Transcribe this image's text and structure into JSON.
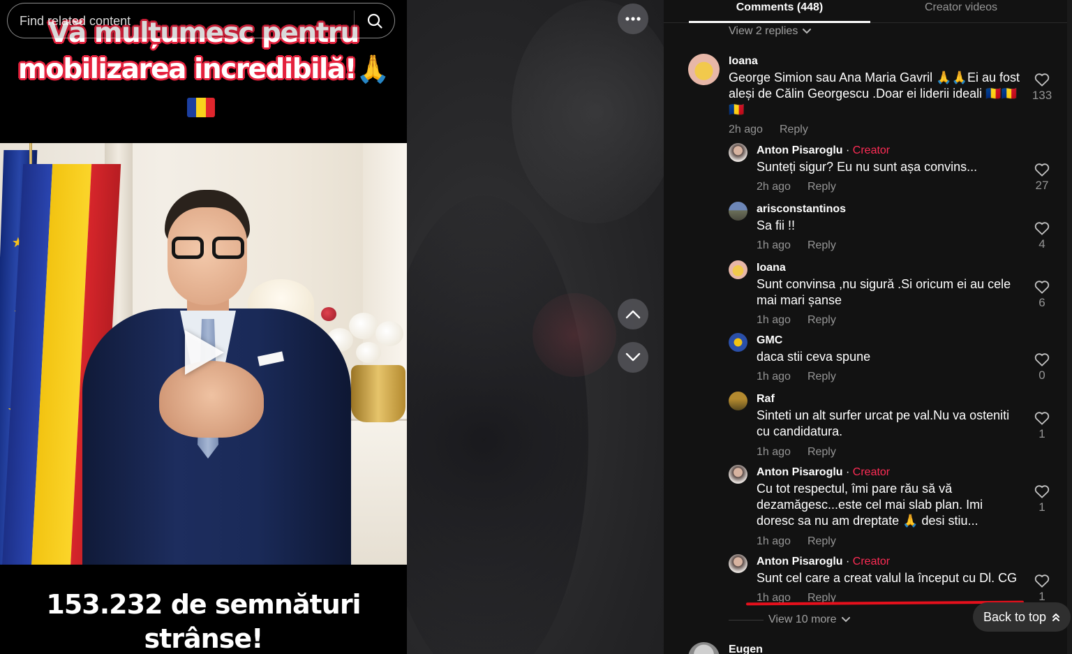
{
  "video": {
    "overlay_line1": "Vă mulțumesc pentru",
    "overlay_line2": "mobilizarea incredibilă!",
    "overlay_emoji": "🙏",
    "caption_line1": "153.232 de semnături",
    "caption_line2": "strânse!"
  },
  "search": {
    "placeholder": "Find related content"
  },
  "tabs": {
    "comments": "Comments (448)",
    "creator_videos": "Creator videos"
  },
  "top_view_replies": "View 2 replies",
  "comments": [
    {
      "user": "Ioana",
      "text": "George Simion sau Ana Maria Gavril 🙏🙏Ei au fost aleși de Călin Georgescu .Doar ei liderii ideali 🇷🇴🇷🇴🇷🇴",
      "time": "2h ago",
      "reply": "Reply",
      "likes": "133"
    },
    {
      "user": "Anton Pisaroglu",
      "badge": "Creator",
      "text": "Sunteți sigur? Eu nu sunt așa convins...",
      "time": "2h ago",
      "reply": "Reply",
      "likes": "27"
    },
    {
      "user": "arisconstantinos",
      "text": "Sa fii !!",
      "time": "1h ago",
      "reply": "Reply",
      "likes": "4"
    },
    {
      "user": "Ioana",
      "text": "Sunt convinsa ,nu sigură .Si oricum ei au cele mai mari șanse",
      "time": "1h ago",
      "reply": "Reply",
      "likes": "6"
    },
    {
      "user": "GMC",
      "text": "daca stii ceva spune",
      "time": "1h ago",
      "reply": "Reply",
      "likes": "0"
    },
    {
      "user": "Raf",
      "text": "Sinteti un alt surfer urcat pe val.Nu va osteniti cu candidatura.",
      "time": "1h ago",
      "reply": "Reply",
      "likes": "1"
    },
    {
      "user": "Anton Pisaroglu",
      "badge": "Creator",
      "text": "Cu tot respectul, îmi pare rău să vă dezamăgesc...este cel mai slab plan. Imi doresc sa nu am dreptate 🙏 desi stiu...",
      "time": "1h ago",
      "reply": "Reply",
      "likes": "1"
    },
    {
      "user": "Anton Pisaroglu",
      "badge": "Creator",
      "text": "Sunt cel care a creat valul la început cu Dl. CG",
      "time": "1h ago",
      "reply": "Reply",
      "likes": "1"
    },
    {
      "user": "Eugen"
    }
  ],
  "view_more": "View 10 more",
  "back_to_top": "Back to top",
  "colors": {
    "creator_badge": "#fe2c55",
    "panel_bg": "#121212",
    "annotation_line": "#e5101c",
    "overlay_outline": "#e5223e"
  },
  "icons": {
    "search": "search-icon",
    "more": "more-horizontal-icon",
    "up": "chevron-up-icon",
    "down": "chevron-down-icon",
    "heart": "heart-icon",
    "play": "play-icon",
    "back_top": "double-chevron-up-icon"
  }
}
